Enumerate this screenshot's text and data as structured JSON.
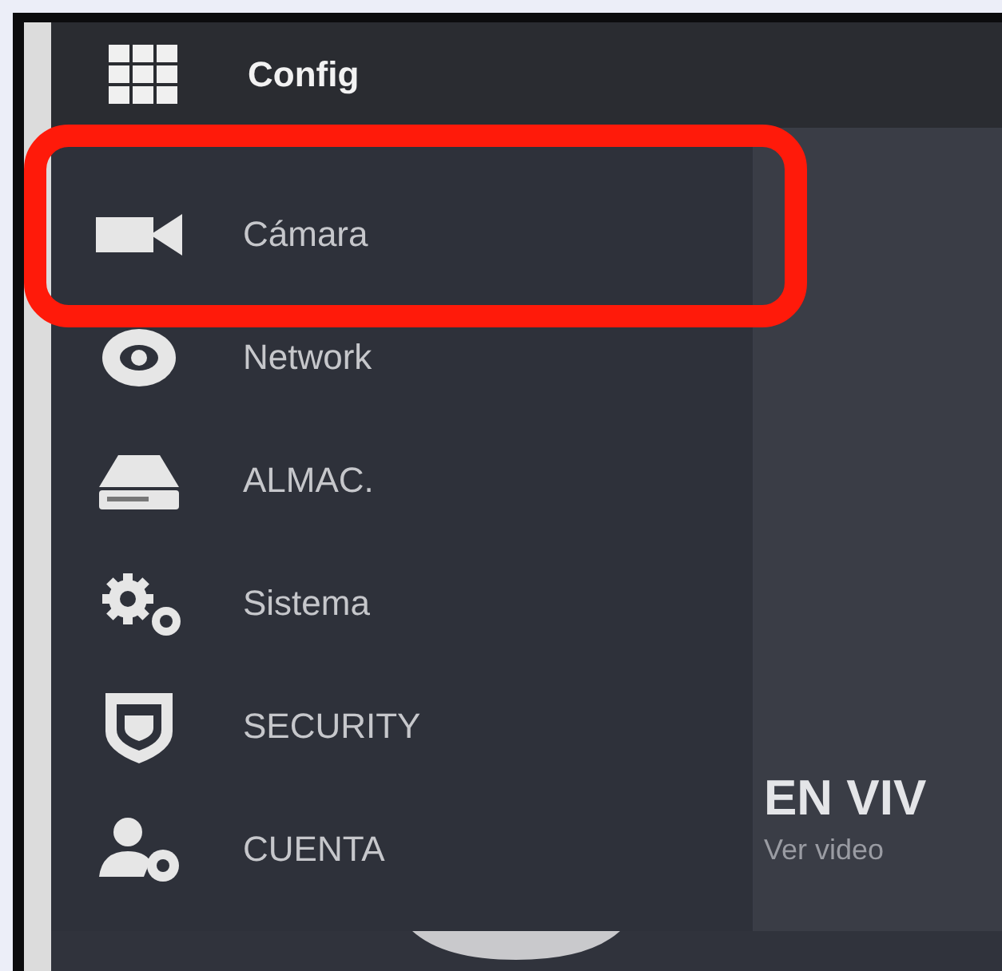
{
  "header": {
    "title": "Config"
  },
  "menu": [
    {
      "kind": "camera",
      "label": "Cámara",
      "highlighted": true
    },
    {
      "kind": "network",
      "label": "Network",
      "highlighted": false
    },
    {
      "kind": "storage",
      "label": "ALMAC.",
      "highlighted": false
    },
    {
      "kind": "system",
      "label": "Sistema",
      "highlighted": false
    },
    {
      "kind": "security",
      "label": "SECURITY",
      "highlighted": false
    },
    {
      "kind": "account",
      "label": "CUENTA",
      "highlighted": false
    }
  ],
  "live": {
    "title": "EN VIV",
    "subtitle": "Ver video"
  }
}
